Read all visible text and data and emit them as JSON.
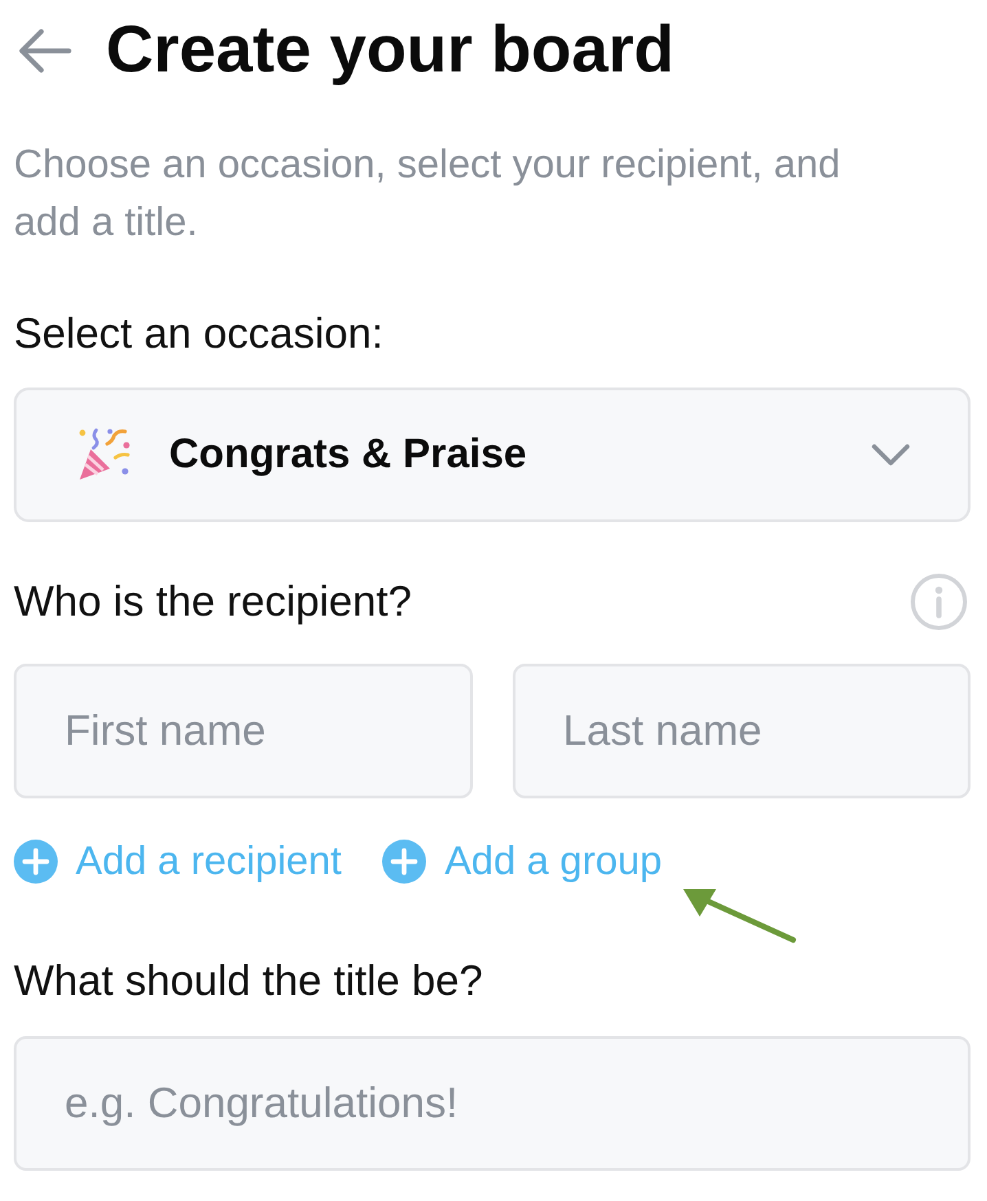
{
  "header": {
    "title": "Create your board"
  },
  "intro": "Choose an occasion, select your recipient, and add a title.",
  "occasion": {
    "label": "Select an occasion:",
    "value": "Congrats & Praise"
  },
  "recipient": {
    "label": "Who is the recipient?",
    "fields": [
      {
        "placeholder": "First name"
      },
      {
        "placeholder": "Last name"
      }
    ],
    "links": [
      "Add a recipient",
      "Add a group"
    ]
  },
  "board_title": {
    "label": "What should the title be?",
    "placeholder": "e.g. Congratulations!"
  }
}
